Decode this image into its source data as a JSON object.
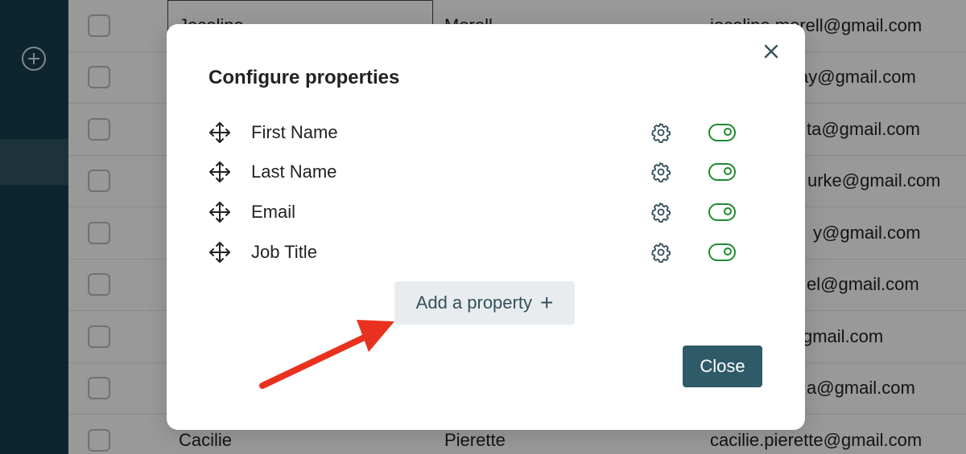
{
  "table": {
    "rows": [
      {
        "first": "Joceline",
        "last": "Morell",
        "email": "joceline.morell@gmail.com"
      },
      {
        "first": "",
        "last": "",
        "email": "ay@gmail.com"
      },
      {
        "first": "",
        "last": "",
        "email": "ta@gmail.com"
      },
      {
        "first": "",
        "last": "",
        "email": "urke@gmail.com"
      },
      {
        "first": "",
        "last": "",
        "email": "y@gmail.com"
      },
      {
        "first": "",
        "last": "",
        "email": "el@gmail.com"
      },
      {
        "first": "",
        "last": "",
        "email": "gmail.com"
      },
      {
        "first": "",
        "last": "",
        "email": "a@gmail.com"
      },
      {
        "first": "Cacilie",
        "last": "Pierette",
        "email": "cacilie.pierette@gmail.com"
      }
    ]
  },
  "modal": {
    "title": "Configure properties",
    "properties": [
      {
        "label": "First Name",
        "enabled": true
      },
      {
        "label": "Last Name",
        "enabled": true
      },
      {
        "label": "Email",
        "enabled": true
      },
      {
        "label": "Job Title",
        "enabled": true
      }
    ],
    "add_property_label": "Add a property",
    "add_property_icon": "+",
    "close_label": "Close"
  },
  "colors": {
    "sidebar": "#163f4e",
    "sidebar_active": "#2f5665",
    "toggle_on": "#1e8a2c",
    "close_button": "#2f5a68",
    "arrow": "#e8321f"
  },
  "icons": {
    "sidebar_add": "plus-circle-icon",
    "drag": "move-arrows-icon",
    "settings": "gear-icon",
    "toggle": "toggle-on-icon",
    "modal_close": "close-icon"
  }
}
